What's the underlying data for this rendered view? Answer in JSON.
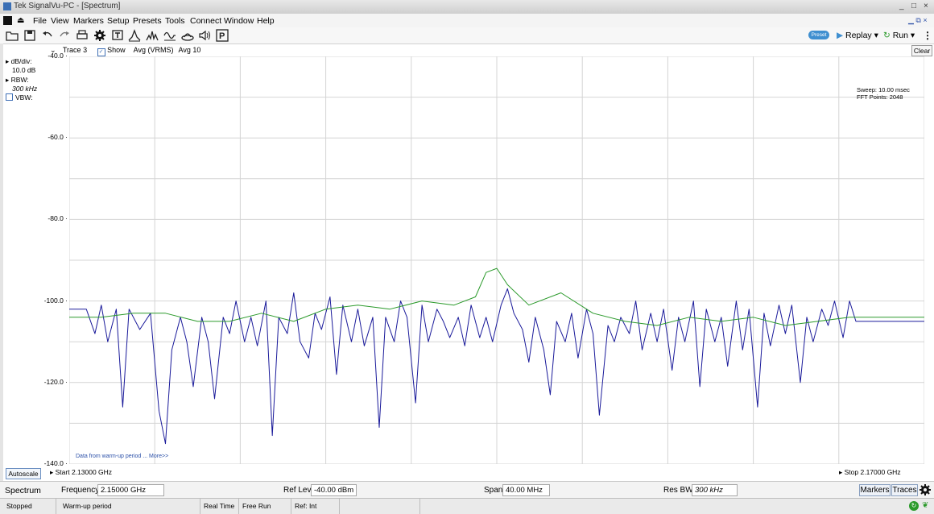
{
  "window": {
    "title": "Tek SignalVu-PC - [Spectrum]",
    "controls": {
      "minimize": "_",
      "maximize": "□",
      "close": "×",
      "mdi_restore": "▁ ⧉ ×"
    }
  },
  "menu": [
    "File",
    "View",
    "Markers",
    "Setup",
    "Presets",
    "Tools",
    "Connect",
    "Window",
    "Help"
  ],
  "toolbar": {
    "icons": [
      "open-folder-icon",
      "save-icon",
      "undo-icon",
      "redo-icon",
      "print-icon",
      "gear-icon",
      "text-marker-icon",
      "peak-marker-icon",
      "spectrum-icon",
      "waveform-icon",
      "hat-icon",
      "speaker-icon",
      "p-icon"
    ],
    "preset": "Preset",
    "replay": "Replay",
    "run": "Run"
  },
  "trace": {
    "name": "Trace 3",
    "show_label": "Show",
    "show_checked": true,
    "detector": "Avg (VRMS)",
    "avg": "Avg 10",
    "clear": "Clear"
  },
  "side": {
    "db_div_label": "dB/div:",
    "db_div_value": "10.0 dB",
    "rbw_label": "RBW:",
    "rbw_value": "300 kHz",
    "vbw_label": "VBW:"
  },
  "sweep_info": {
    "sweep": "Sweep: 10.00 msec",
    "fft": "FFT Points: 2048"
  },
  "warmup_note": "Data from warm-up period ... More>>",
  "autoscale": "Autoscale",
  "start": "Start  2.13000 GHz",
  "stop": "Stop  2.17000 GHz",
  "controls": {
    "view": "Spectrum",
    "frequency_label": "Frequency",
    "frequency_value": "2.15000 GHz",
    "reflev_label": "Ref Lev",
    "reflev_value": "-40.00 dBm",
    "span_label": "Span",
    "span_value": "40.00 MHz",
    "resbw_label": "Res BW",
    "resbw_value": "300 kHz",
    "markers_btn": "Markers",
    "traces_btn": "Traces"
  },
  "status": [
    "Stopped",
    "Warm-up period",
    "Real Time",
    "Free Run",
    "Ref: Int"
  ],
  "colors": {
    "grid": "#d4d4d4",
    "trace_blue": "#1a1a9a",
    "trace_green": "#2b9a2b",
    "preset": "#3f8fd0"
  },
  "chart_data": {
    "type": "line",
    "xlabel": "",
    "ylabel": "",
    "xlim": [
      2.13,
      2.17
    ],
    "ylim": [
      -140,
      -40
    ],
    "y_ticks": [
      "-40.0",
      "-60.0",
      "-80.0",
      "-100.0",
      "-120.0",
      "-140.0"
    ],
    "grid": true,
    "series": [
      {
        "name": "",
        "color": "#1a1a9a",
        "x": [
          2.13,
          2.1308,
          2.1312,
          2.1315,
          2.1318,
          2.1322,
          2.1325,
          2.1328,
          2.1333,
          2.1338,
          2.1342,
          2.1345,
          2.1348,
          2.1352,
          2.1355,
          2.1358,
          2.1362,
          2.1365,
          2.1368,
          2.1372,
          2.1375,
          2.1378,
          2.1382,
          2.1385,
          2.1388,
          2.1392,
          2.1395,
          2.1398,
          2.1402,
          2.1405,
          2.1408,
          2.1412,
          2.1415,
          2.1418,
          2.1422,
          2.1425,
          2.1428,
          2.1432,
          2.1435,
          2.1438,
          2.1442,
          2.1445,
          2.1448,
          2.1452,
          2.1455,
          2.1458,
          2.1462,
          2.1465,
          2.1468,
          2.1472,
          2.1475,
          2.1478,
          2.1482,
          2.1485,
          2.1488,
          2.1492,
          2.1495,
          2.1498,
          2.1502,
          2.1505,
          2.1508,
          2.1512,
          2.1515,
          2.1518,
          2.1522,
          2.1525,
          2.1528,
          2.1532,
          2.1535,
          2.1538,
          2.1542,
          2.1545,
          2.1548,
          2.1552,
          2.1555,
          2.1558,
          2.1562,
          2.1565,
          2.1568,
          2.1572,
          2.1575,
          2.1578,
          2.1582,
          2.1585,
          2.1588,
          2.1592,
          2.1595,
          2.1598,
          2.1602,
          2.1605,
          2.1608,
          2.1612,
          2.1615,
          2.1618,
          2.1622,
          2.1625,
          2.1628,
          2.1632,
          2.1635,
          2.1638,
          2.1642,
          2.1645,
          2.1648,
          2.1652,
          2.1655,
          2.1658,
          2.1662,
          2.1665,
          2.1668,
          2.17
        ],
        "y": [
          -102,
          -102,
          -108,
          -101,
          -110,
          -102,
          -126,
          -102,
          -107,
          -103,
          -127,
          -135,
          -112,
          -104,
          -110,
          -121,
          -104,
          -110,
          -124,
          -104,
          -108,
          -100,
          -110,
          -104,
          -111,
          -100,
          -133,
          -104,
          -108,
          -98,
          -110,
          -114,
          -103,
          -107,
          -99,
          -118,
          -101,
          -110,
          -102,
          -111,
          -104,
          -131,
          -104,
          -110,
          -100,
          -104,
          -125,
          -101,
          -110,
          -102,
          -105,
          -109,
          -104,
          -111,
          -101,
          -109,
          -104,
          -110,
          -101,
          -97,
          -103,
          -107,
          -115,
          -104,
          -112,
          -123,
          -105,
          -110,
          -103,
          -114,
          -102,
          -108,
          -128,
          -106,
          -110,
          -104,
          -108,
          -100,
          -112,
          -103,
          -110,
          -102,
          -117,
          -104,
          -110,
          -100,
          -121,
          -102,
          -110,
          -104,
          -116,
          -100,
          -112,
          -102,
          -126,
          -103,
          -111,
          -101,
          -108,
          -101,
          -120,
          -104,
          -110,
          -102,
          -106,
          -100,
          -109,
          -100,
          -105,
          -105
        ]
      },
      {
        "name": "",
        "color": "#2b9a2b",
        "x": [
          2.13,
          2.1315,
          2.133,
          2.1345,
          2.136,
          2.1375,
          2.139,
          2.1405,
          2.142,
          2.1435,
          2.145,
          2.1465,
          2.148,
          2.149,
          2.1495,
          2.15,
          2.1505,
          2.1515,
          2.153,
          2.1545,
          2.156,
          2.1575,
          2.159,
          2.1605,
          2.162,
          2.1635,
          2.165,
          2.1665,
          2.17
        ],
        "y": [
          -104,
          -104,
          -103,
          -103,
          -105,
          -105,
          -103,
          -105,
          -102,
          -101,
          -102,
          -100,
          -101,
          -99,
          -93,
          -92,
          -96,
          -101,
          -98,
          -103,
          -105,
          -106,
          -104,
          -105,
          -104,
          -106,
          -105,
          -104,
          -104
        ]
      }
    ]
  }
}
